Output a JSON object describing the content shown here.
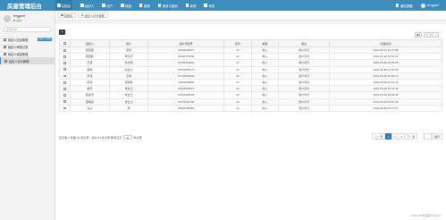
{
  "app": {
    "title": "房屋管理后台"
  },
  "topnav": {
    "items": [
      {
        "label": "控制台",
        "icon": "home-icon"
      },
      {
        "label": "经纪人",
        "icon": "user-icon"
      },
      {
        "label": "用户",
        "icon": "users-icon"
      },
      {
        "label": "楼盘",
        "icon": "building-icon"
      },
      {
        "label": "管理",
        "icon": "list-icon"
      },
      {
        "label": "服务与营销",
        "icon": "chart-icon"
      },
      {
        "label": "新闻",
        "icon": "news-icon"
      },
      {
        "label": "系统",
        "icon": "gear-icon"
      }
    ],
    "notice_label": "通知提醒",
    "user_label": "fengpeel"
  },
  "sidebar": {
    "user_name": "fengpeel",
    "status": "在线",
    "search_placeholder": "搜索菜单",
    "items": [
      {
        "label": "经纪人信息管理",
        "badge": "经纪人管理"
      },
      {
        "label": "经纪人审核记录"
      },
      {
        "label": "经纪人佣金管理"
      },
      {
        "label": "经纪人评分管理"
      }
    ]
  },
  "tabs": [
    {
      "label": "控制台"
    },
    {
      "label": "经纪人评分管理"
    }
  ],
  "toolbar": {
    "add_label": "+"
  },
  "table": {
    "headers": [
      "",
      "经纪人",
      "用户",
      "用户手机号",
      "评分",
      "类型",
      "备注",
      "创建时间"
    ],
    "rows": [
      [
        "",
        "张国强",
        "张欣",
        "13546245577",
        "10",
        "收入",
        "用户评分",
        "2022-05-31 10:27:58"
      ],
      [
        "",
        "杨西鹏",
        "黄尔天",
        "15182712800",
        "10",
        "收入",
        "用户评分",
        "2022-05-30 16:54:18"
      ],
      [
        "",
        "王娇",
        "杜欣雨",
        "15735432820",
        "10",
        "收入",
        "用户评分",
        "2022-05-30 16:45:25"
      ],
      [
        "",
        "蔡琳",
        "冯女士",
        "18736465121",
        "10",
        "收入",
        "用户评分",
        "2022-05-30 16:46:45"
      ],
      [
        "",
        "周海",
        "王琳",
        "15735453608",
        "10",
        "收入",
        "用户评分",
        "2022-05-29 16:56:10"
      ],
      [
        "",
        "周海",
        "贾鹏跃",
        "15836939800",
        "10",
        "收入",
        "用户评分",
        "2022-05-29 19:14:46"
      ],
      [
        "",
        "胡巧",
        "朱女士",
        "15935435673",
        "10",
        "收入",
        "用户评分",
        "2022-05-29 19:01:40"
      ],
      [
        "",
        "蔡鑫茂",
        "朱女士",
        "15935435230",
        "10",
        "收入",
        "用户评分",
        "2022-05-29 18:55:36"
      ],
      [
        "",
        "董曦源",
        "张女士",
        "15735432756",
        "10",
        "收入",
        "用户评分",
        "2022-05-29 15:57:20"
      ],
      [
        "",
        "冯兴",
        "朱",
        "15935405660",
        "10",
        "收入",
        "用户评分",
        "2022-05-28 15:57:07"
      ]
    ]
  },
  "footer": {
    "info_prefix": "显示第 1 到第 10 条记录，总共 24 条记录 每页显示",
    "page_size": "10",
    "info_suffix": "条记录"
  },
  "pager": {
    "prev": "上一页",
    "pages": [
      "1",
      "2",
      "3"
    ],
    "next": "下一页",
    "jump_label": "跳转"
  },
  "watermark": "CSDN @毕设程序员2022"
}
